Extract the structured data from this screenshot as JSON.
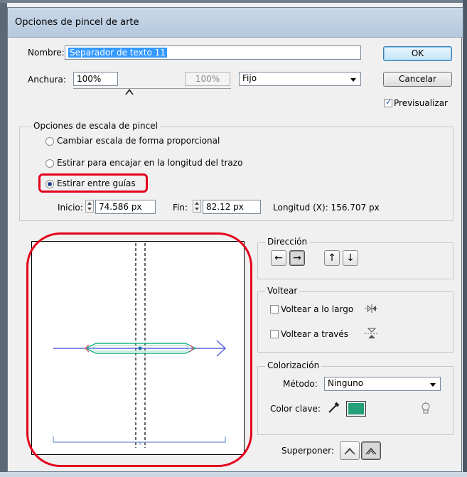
{
  "window": {
    "title": "Opciones de pincel de arte"
  },
  "name_field": {
    "label": "Nombre:",
    "value": "Separador de texto 11"
  },
  "width_field": {
    "label": "Anchura:",
    "value": "100%",
    "secondary": "100%",
    "mode": "Fijo"
  },
  "buttons": {
    "ok": "OK",
    "cancel": "Cancelar"
  },
  "preview": {
    "label": "Previsualizar",
    "checked": true
  },
  "scale_options": {
    "title": "Opciones de escala de pincel",
    "options": [
      {
        "label": "Cambiar escala de forma proporcional",
        "selected": false
      },
      {
        "label": "Estirar para encajar en la longitud del trazo",
        "selected": false
      },
      {
        "label": "Estirar entre guías",
        "selected": true
      }
    ],
    "start_label": "Inicio:",
    "start_value": "74.586 px",
    "end_label": "Fin:",
    "end_value": "82.12 px",
    "length_text": "Longitud (X): 156.707 px"
  },
  "direction": {
    "title": "Dirección",
    "buttons": [
      "←",
      "→",
      "↑",
      "↓"
    ],
    "selected_index": 1
  },
  "flip": {
    "title": "Voltear",
    "along_label": "Voltear a lo largo",
    "across_label": "Voltear a través"
  },
  "colorization": {
    "title": "Colorización",
    "method_label": "Método:",
    "method_value": "Ninguno",
    "key_color_label": "Color clave:",
    "key_color": "#23a07a"
  },
  "overlap": {
    "label": "Superponer:"
  },
  "preview_colors": {
    "path": "#5a64e0",
    "brush": "#1db28a",
    "tip": "#e0607a",
    "guides": "#000000"
  }
}
